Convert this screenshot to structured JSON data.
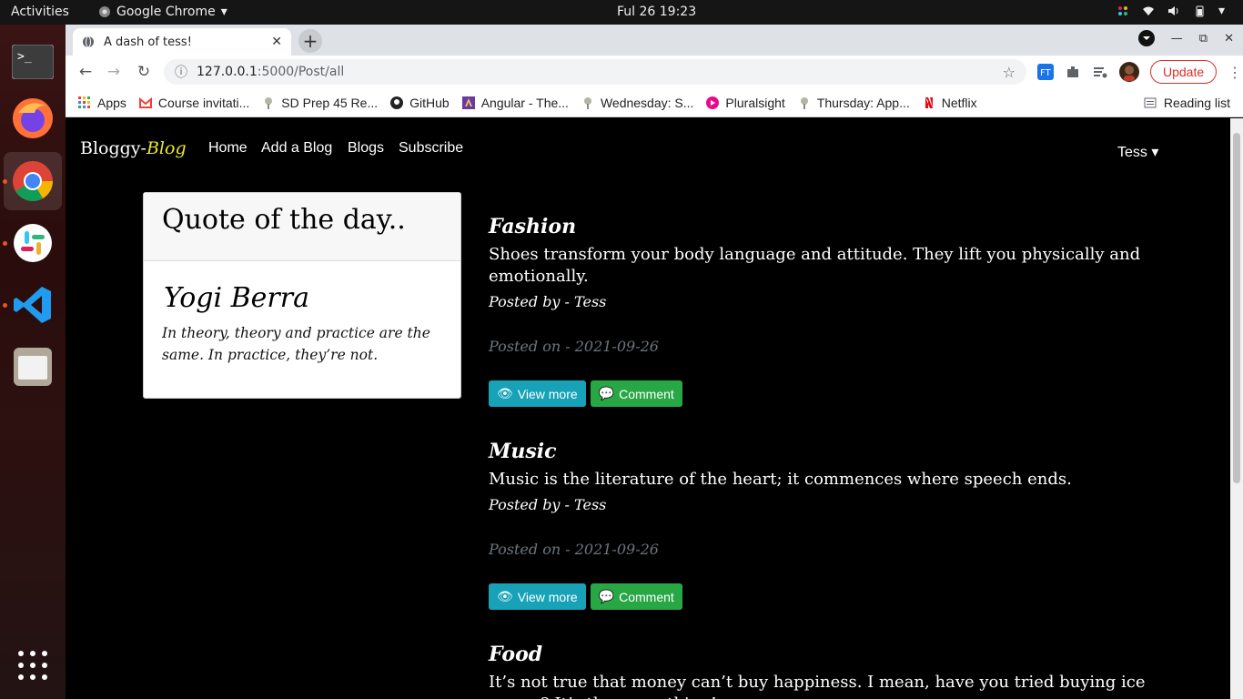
{
  "system": {
    "activities": "Activities",
    "app_name": "Google Chrome",
    "clock": "Ful 26  19:23"
  },
  "browser": {
    "tab_title": "A dash of tess!",
    "url_host": "127.0.0.1",
    "url_path": ":5000/Post/all",
    "update_label": "Update",
    "reading_list": "Reading list",
    "bookmarks": [
      "Apps",
      "Course invitati...",
      "SD Prep 45 Re...",
      "GitHub",
      "Angular - The...",
      "Wednesday: S...",
      "Pluralsight",
      "Thursday: App...",
      "Netflix"
    ]
  },
  "site": {
    "brand_prefix": "Bloggy-",
    "brand_accent": "Blog",
    "nav": [
      "Home",
      "Add a Blog",
      "Blogs",
      "Subscribe"
    ],
    "user": "Tess"
  },
  "quote": {
    "header": "Quote of the day..",
    "author": "Yogi Berra",
    "text": "In theory, theory and practice are the same. In practice, they’re not."
  },
  "posts": [
    {
      "title": "Fashion",
      "body": "Shoes transform your body language and attitude. They lift you physically and emotionally.",
      "author": "Posted by - Tess",
      "date": "Posted on - 2021-09-26",
      "view_label": "View more",
      "comment_label": "Comment"
    },
    {
      "title": "Music",
      "body": "Music is the literature of the heart; it commences where speech ends.",
      "author": "Posted by - Tess",
      "date": "Posted on - 2021-09-26",
      "view_label": "View more",
      "comment_label": "Comment"
    },
    {
      "title": "Food",
      "body": "It’s not true that money can’t buy happiness. I mean, have you tried buying ice cream? It’s the same thing!"
    }
  ],
  "colors": {
    "brand_accent": "#e9e92a",
    "btn_info": "#17a2b8",
    "btn_success": "#28a745",
    "muted": "#6c757d",
    "update_red": "#d93025"
  }
}
